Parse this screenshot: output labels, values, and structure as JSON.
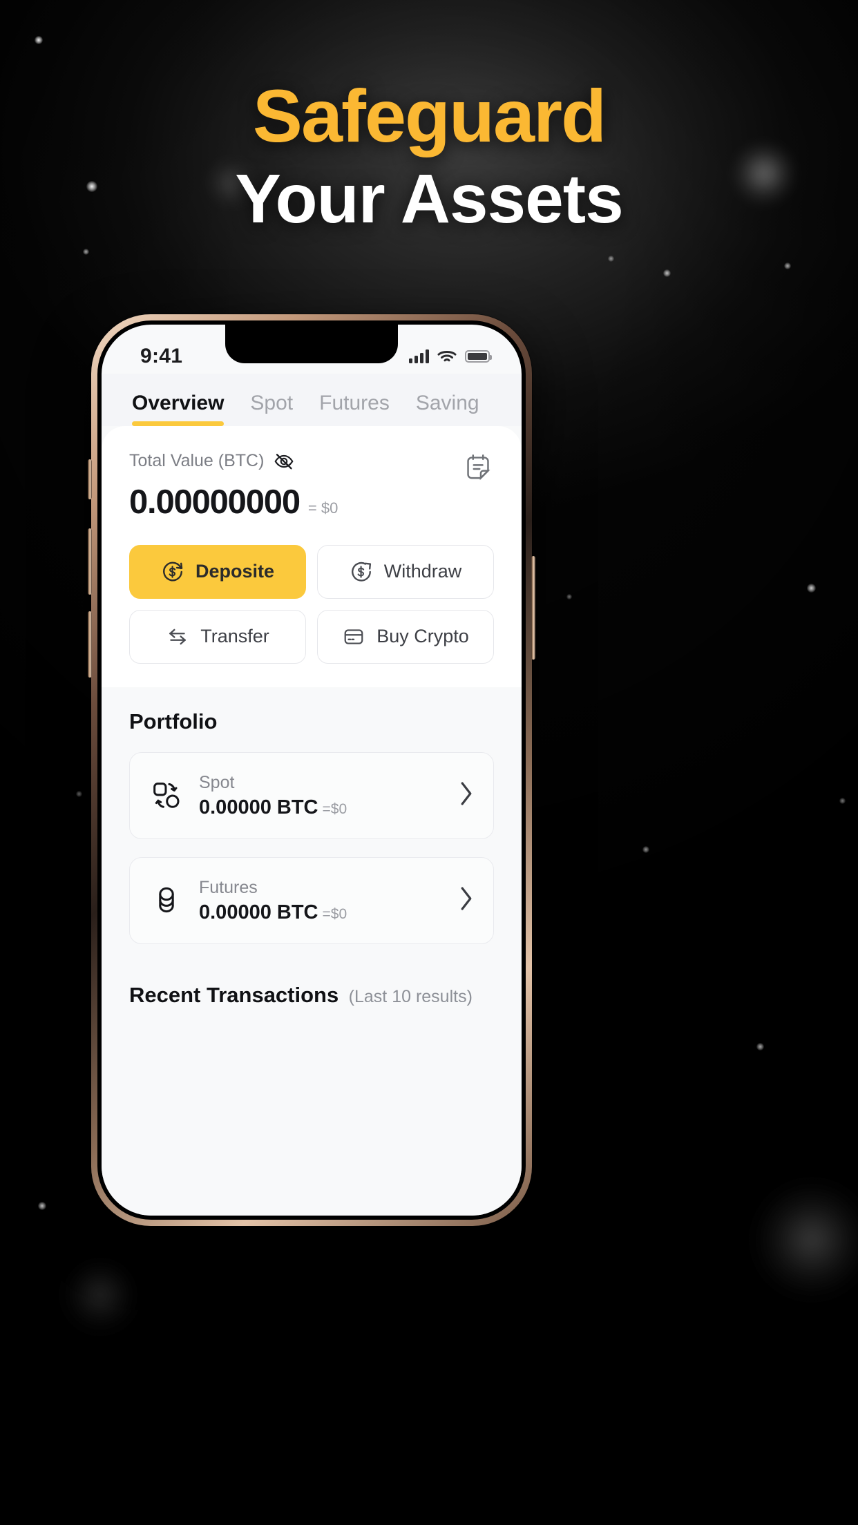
{
  "hero": {
    "line1": "Safeguard",
    "line2": "Your Assets",
    "line1_color": "#fbb833",
    "line2_color": "#ffffff"
  },
  "phone": {
    "status_bar": {
      "time": "9:41",
      "icons": [
        "signal-bars-icon",
        "wifi-icon",
        "battery-icon"
      ]
    },
    "tabs": [
      {
        "label": "Overview",
        "active": true
      },
      {
        "label": "Spot",
        "active": false
      },
      {
        "label": "Futures",
        "active": false
      },
      {
        "label": "Saving",
        "active": false
      }
    ],
    "tab_accent": "#fbc93d",
    "balance": {
      "label": "Total Value (BTC)",
      "hide_icon": "eye-off-icon",
      "notes_icon": "notepad-icon",
      "value": "0.00000000",
      "usd": "= $0"
    },
    "actions": [
      {
        "label": "Deposite",
        "icon": "deposit-circle-icon",
        "primary": true
      },
      {
        "label": "Withdraw",
        "icon": "withdraw-circle-icon",
        "primary": false
      },
      {
        "label": "Transfer",
        "icon": "transfer-arrows-icon",
        "primary": false
      },
      {
        "label": "Buy Crypto",
        "icon": "credit-card-icon",
        "primary": false
      }
    ],
    "portfolio": {
      "title": "Portfolio",
      "rows": [
        {
          "name": "Spot",
          "amount": "0.00000 BTC",
          "usd": "=$0",
          "icon": "spot-shapes-icon"
        },
        {
          "name": "Futures",
          "amount": "0.00000 BTC",
          "usd": "=$0",
          "icon": "coins-stack-icon"
        }
      ]
    },
    "recent": {
      "title": "Recent Transactions",
      "subtitle": "(Last 10 results)"
    }
  }
}
